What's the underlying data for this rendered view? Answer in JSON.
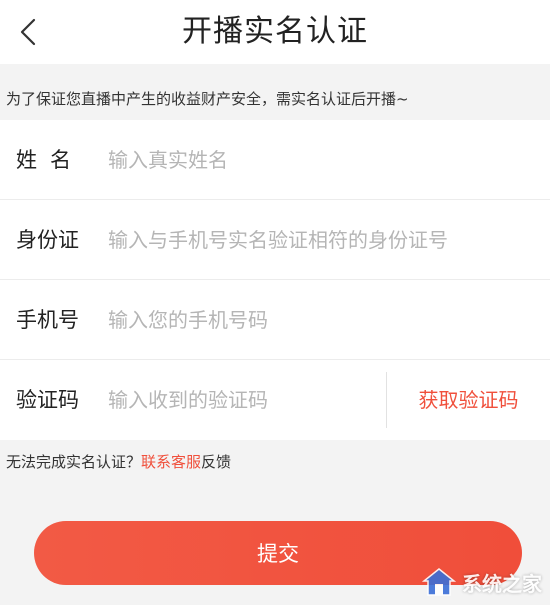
{
  "header": {
    "title": "开播实名认证",
    "back_icon": "chevron-left-icon"
  },
  "notice": "为了保证您直播中产生的收益财产安全，需实名认证后开播~",
  "form": {
    "name": {
      "label": "姓名",
      "placeholder": "输入真实姓名",
      "value": ""
    },
    "id_card": {
      "label": "身份证",
      "placeholder": "输入与手机号实名验证相符的身份证号",
      "value": ""
    },
    "phone": {
      "label": "手机号",
      "placeholder": "输入您的手机号码",
      "value": ""
    },
    "code": {
      "label": "验证码",
      "placeholder": "输入收到的验证码",
      "value": "",
      "get_code_label": "获取验证码"
    }
  },
  "help": {
    "prefix": "无法完成实名认证？",
    "link": "联系客服",
    "suffix": "反馈"
  },
  "submit_label": "提交",
  "watermark": {
    "text": "系统之家"
  },
  "colors": {
    "accent": "#f0503c",
    "background": "#f3f3f3"
  }
}
